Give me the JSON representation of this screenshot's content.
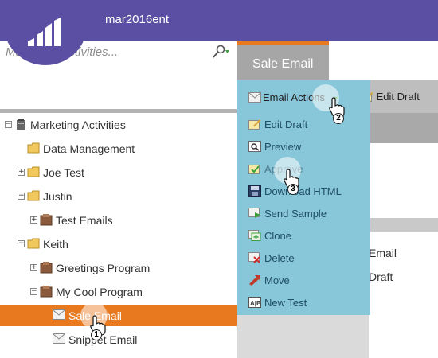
{
  "header": {
    "instance": "mar2016ent"
  },
  "search": {
    "placeholder": "Marketing Activities..."
  },
  "tree": {
    "root": "Marketing Activities",
    "items": [
      {
        "label": "Data Management"
      },
      {
        "label": "Joe Test"
      },
      {
        "label": "Justin"
      },
      {
        "label": "Test Emails"
      },
      {
        "label": "Keith"
      },
      {
        "label": "Greetings Program"
      },
      {
        "label": "My Cool Program"
      },
      {
        "label": "Sale Email"
      },
      {
        "label": "Snippet Email"
      }
    ]
  },
  "tab": {
    "label": "Sale Email"
  },
  "toolbar": {
    "email_actions": "Email Actions",
    "edit_draft": "Edit Draft"
  },
  "menu": {
    "items": [
      {
        "label": "Edit Draft"
      },
      {
        "label": "Preview"
      },
      {
        "label": "Approve"
      },
      {
        "label": "Download HTML"
      },
      {
        "label": "Send Sample"
      },
      {
        "label": "Clone"
      },
      {
        "label": "Delete"
      },
      {
        "label": "Move"
      },
      {
        "label": "New Test"
      }
    ]
  },
  "background_peek": {
    "line1": "Email",
    "line2": "Draft"
  },
  "steps": {
    "one": "1",
    "two": "2",
    "three": "3"
  },
  "colors": {
    "header": "#5b4fa3",
    "selected": "#e8791f",
    "menu": "#88c6d9"
  }
}
